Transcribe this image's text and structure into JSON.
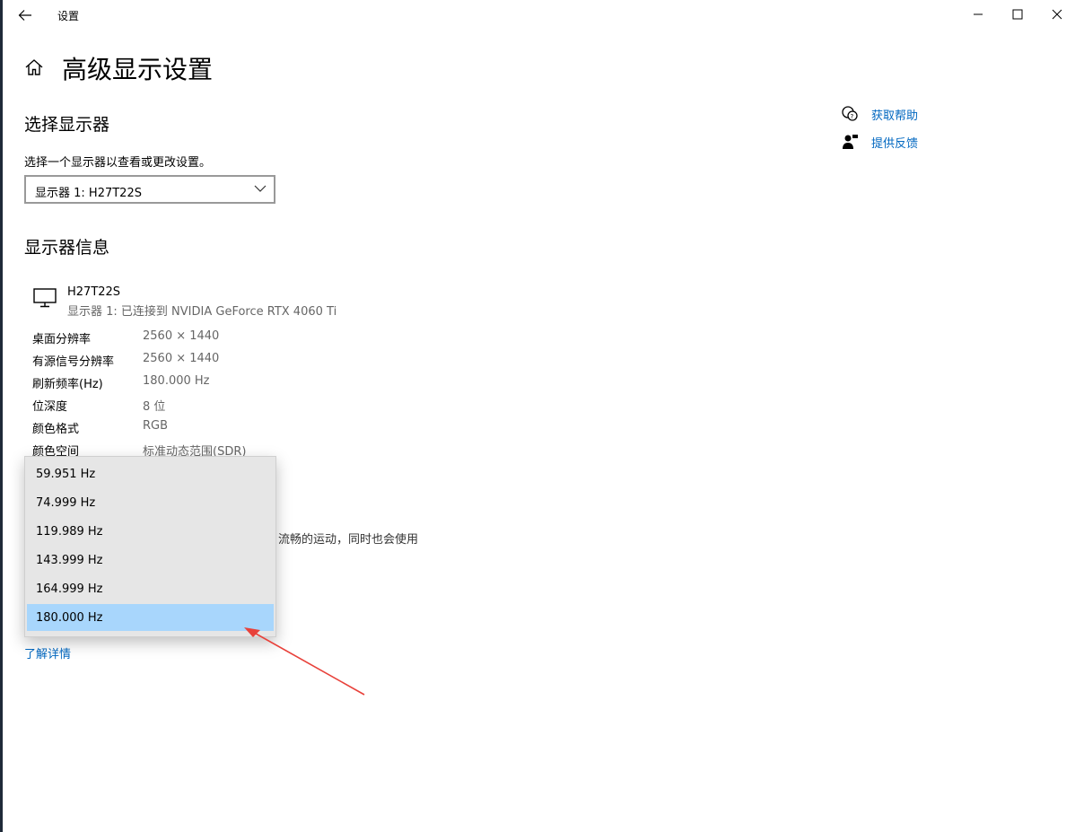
{
  "window": {
    "title": "设置",
    "accent_color": "#0067c0"
  },
  "header": {
    "title": "高级显示设置"
  },
  "select_display": {
    "heading": "选择显示器",
    "prompt": "选择一个显示器以查看或更改设置。",
    "selected": "显示器 1: H27T22S"
  },
  "help_links": [
    {
      "label": "获取帮助",
      "icon": "help-chat-icon"
    },
    {
      "label": "提供反馈",
      "icon": "feedback-person-icon"
    }
  ],
  "display_info": {
    "heading": "显示器信息",
    "monitor_name": "H27T22S",
    "monitor_sub": "显示器 1: 已连接到 NVIDIA GeForce RTX 4060 Ti",
    "rows": [
      {
        "key": "桌面分辨率",
        "value": "2560 × 1440"
      },
      {
        "key": "有源信号分辨率",
        "value": "2560 × 1440"
      },
      {
        "key": "刷新频率(Hz)",
        "value": "180.000 Hz"
      },
      {
        "key": "位深度",
        "value": "8 位"
      },
      {
        "key": "颜色格式",
        "value": "RGB"
      },
      {
        "key": "颜色空间",
        "value": "标准动态范围(SDR)"
      }
    ]
  },
  "refresh_rate": {
    "description_fragment": "流畅的运动，同时也会使用",
    "learn_more": "了解详情",
    "options": [
      "59.951 Hz",
      "74.999 Hz",
      "119.989 Hz",
      "143.999 Hz",
      "164.999 Hz",
      "180.000 Hz"
    ],
    "selected": "180.000 Hz",
    "highlight_color": "#a8d6fc"
  },
  "annotation": {
    "arrow_color": "#e8413a"
  }
}
